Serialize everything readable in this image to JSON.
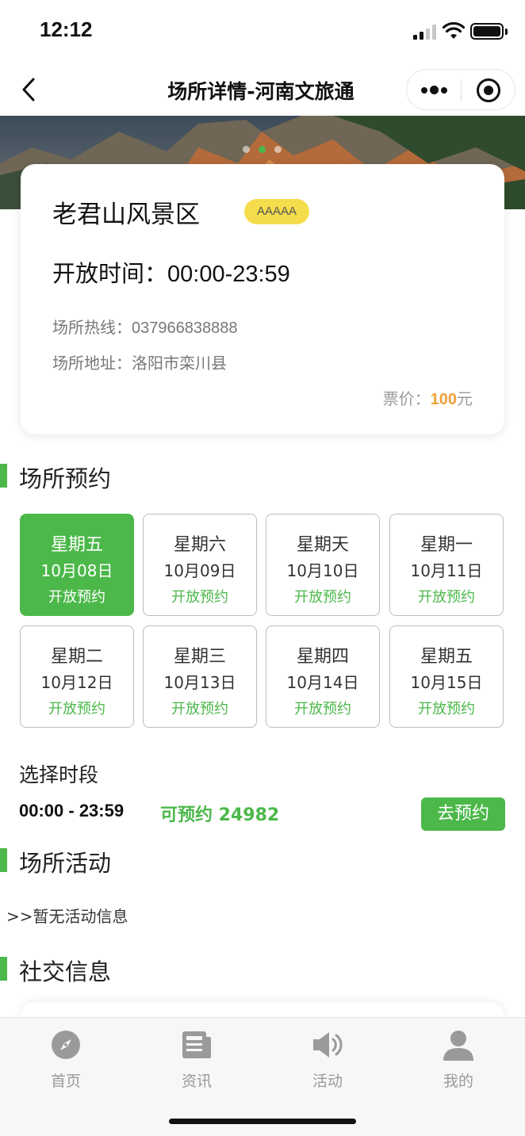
{
  "status_bar": {
    "time": "12:12"
  },
  "nav": {
    "title": "场所详情-河南文旅通"
  },
  "venue": {
    "name": "老君山风景区",
    "rating": "AAAAA",
    "hours_label": "开放时间：",
    "hours_value": "00:00-23:59",
    "hotline_label": "场所热线：",
    "hotline_value": "037966838888",
    "address_label": "场所地址：",
    "address_value": "洛阳市栾川县",
    "price_label": "票价：",
    "price_value": "100",
    "price_unit": "元"
  },
  "reservation": {
    "title": "场所预约",
    "dates": [
      {
        "weekday": "星期五",
        "date": "10月08日",
        "status": "开放预约",
        "selected": true
      },
      {
        "weekday": "星期六",
        "date": "10月09日",
        "status": "开放预约",
        "selected": false
      },
      {
        "weekday": "星期天",
        "date": "10月10日",
        "status": "开放预约",
        "selected": false
      },
      {
        "weekday": "星期一",
        "date": "10月11日",
        "status": "开放预约",
        "selected": false
      },
      {
        "weekday": "星期二",
        "date": "10月12日",
        "status": "开放预约",
        "selected": false
      },
      {
        "weekday": "星期三",
        "date": "10月13日",
        "status": "开放预约",
        "selected": false
      },
      {
        "weekday": "星期四",
        "date": "10月14日",
        "status": "开放预约",
        "selected": false
      },
      {
        "weekday": "星期五",
        "date": "10月15日",
        "status": "开放预约",
        "selected": false
      }
    ]
  },
  "timeslot": {
    "title": "选择时段",
    "time": "00:00 - 23:59",
    "availability": "可预约 24982",
    "book_label": "去预约"
  },
  "activities": {
    "title": "场所活动",
    "empty_text": ">>暂无活动信息"
  },
  "social": {
    "title": "社交信息"
  },
  "tabs": [
    {
      "label": "首页",
      "icon": "compass-icon"
    },
    {
      "label": "资讯",
      "icon": "news-icon"
    },
    {
      "label": "活动",
      "icon": "speaker-icon"
    },
    {
      "label": "我的",
      "icon": "user-icon"
    }
  ],
  "colors": {
    "accent": "#4cb84a",
    "rating_badge": "#f5dc4c",
    "price": "#f0a23a"
  }
}
